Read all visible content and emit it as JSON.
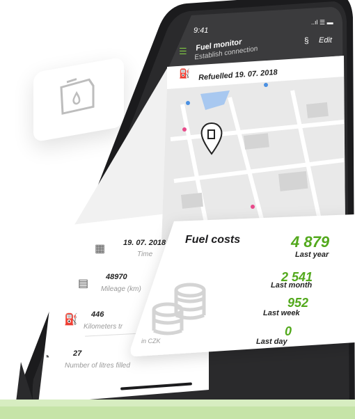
{
  "status_bar": {
    "time": "9:41",
    "icons": "..ıl ☰ ▬"
  },
  "app_bar": {
    "title": "Fuel monitor",
    "subtitle": "Establish connection",
    "edit_label": "Edit"
  },
  "refuel": {
    "label": "Refuelled 19. 07. 2018"
  },
  "details": {
    "rows": [
      {
        "value": "19. 07. 2018",
        "label": "Time"
      },
      {
        "value": "48970",
        "label": "Mileage (km)"
      },
      {
        "value": "446",
        "label": "Kilometers tr"
      },
      {
        "value": "27",
        "label": "Number of litres filled"
      }
    ],
    "currency_note": "in CZK"
  },
  "fuel_costs": {
    "title": "Fuel costs",
    "items": [
      {
        "value": "4 879",
        "label": "Last year"
      },
      {
        "value": "2 541",
        "label": "Last month"
      },
      {
        "value": "952",
        "label": "Last week"
      },
      {
        "value": "0",
        "label": "Last day"
      }
    ]
  },
  "colors": {
    "accent": "#53a91d",
    "dark": "#1b1b1d",
    "band": "#c6e4a8"
  }
}
